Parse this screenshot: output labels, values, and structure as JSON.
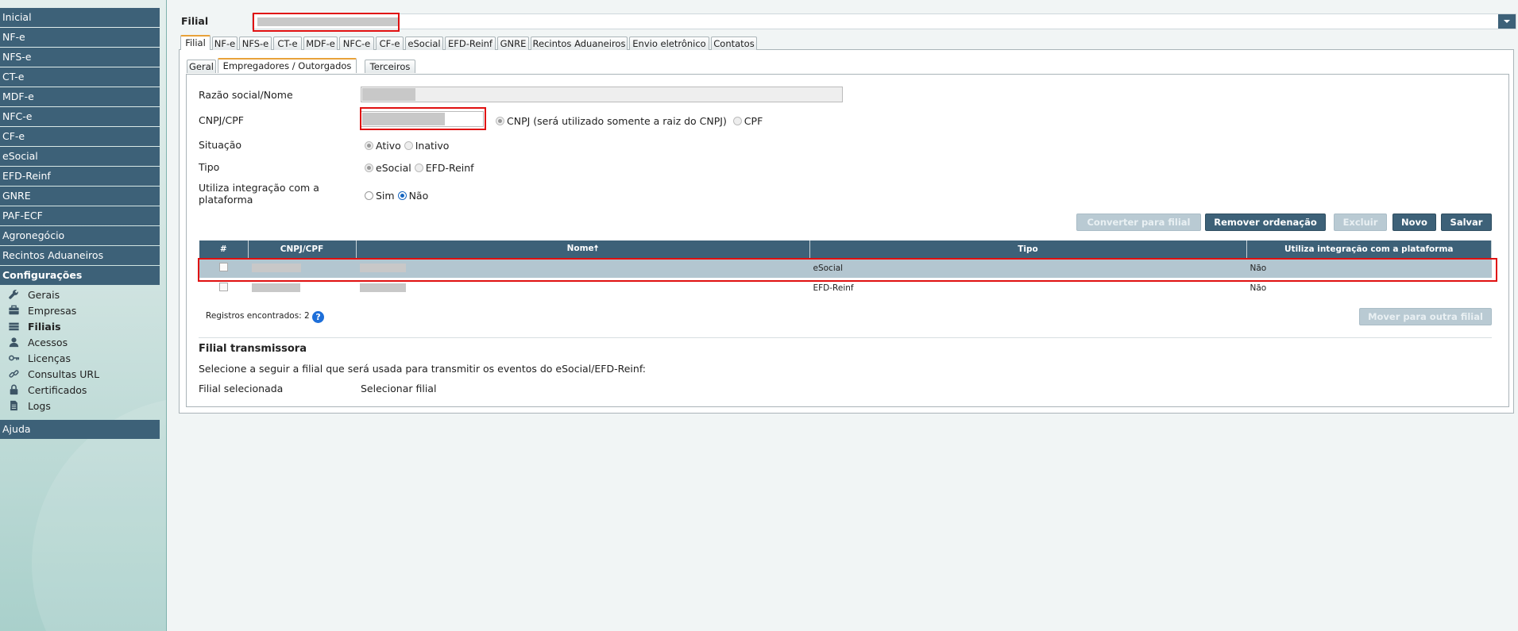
{
  "sidebar": {
    "items": [
      {
        "label": "Inicial"
      },
      {
        "label": "NF-e"
      },
      {
        "label": "NFS-e"
      },
      {
        "label": "CT-e"
      },
      {
        "label": "MDF-e"
      },
      {
        "label": "NFC-e"
      },
      {
        "label": "CF-e"
      },
      {
        "label": "eSocial"
      },
      {
        "label": "EFD-Reinf"
      },
      {
        "label": "GNRE"
      },
      {
        "label": "PAF-ECF"
      },
      {
        "label": "Agronegócio"
      },
      {
        "label": "Recintos Aduaneiros"
      }
    ],
    "config_label": "Configurações",
    "config_items": [
      {
        "label": "Gerais",
        "icon": "wrench-icon"
      },
      {
        "label": "Empresas",
        "icon": "briefcase-icon"
      },
      {
        "label": "Filiais",
        "icon": "building-icon"
      },
      {
        "label": "Acessos",
        "icon": "user-icon"
      },
      {
        "label": "Licenças",
        "icon": "key-icon"
      },
      {
        "label": "Consultas URL",
        "icon": "link-icon"
      },
      {
        "label": "Certificados",
        "icon": "lock-icon"
      },
      {
        "label": "Logs",
        "icon": "document-icon"
      }
    ],
    "help_label": "Ajuda"
  },
  "header": {
    "filial_label": "Filial"
  },
  "main_tabs": [
    {
      "label": "Filial"
    },
    {
      "label": "NF-e"
    },
    {
      "label": "NFS-e"
    },
    {
      "label": "CT-e"
    },
    {
      "label": "MDF-e"
    },
    {
      "label": "NFC-e"
    },
    {
      "label": "CF-e"
    },
    {
      "label": "eSocial"
    },
    {
      "label": "EFD-Reinf"
    },
    {
      "label": "GNRE"
    },
    {
      "label": "Recintos Aduaneiros"
    },
    {
      "label": "Envio eletrônico"
    },
    {
      "label": "Contatos"
    }
  ],
  "sub_tabs": [
    {
      "label": "Geral"
    },
    {
      "label": "Empregadores / Outorgados"
    },
    {
      "label": "Terceiros"
    }
  ],
  "form": {
    "razao_label": "Razão social/Nome",
    "cnpj_label": "CNPJ/CPF",
    "cnpj_opt": "CNPJ (será utilizado somente a raiz do CNPJ)",
    "cpf_opt": "CPF",
    "situacao_label": "Situação",
    "ativo": "Ativo",
    "inativo": "Inativo",
    "tipo_label": "Tipo",
    "esocial": "eSocial",
    "efd": "EFD-Reinf",
    "integ_label_1": "Utiliza integração com a",
    "integ_label_2": "plataforma",
    "sim": "Sim",
    "nao": "Não"
  },
  "buttons": {
    "converter": "Converter para filial",
    "remover": "Remover ordenação",
    "excluir": "Excluir",
    "novo": "Novo",
    "salvar": "Salvar",
    "mover": "Mover para outra filial"
  },
  "table": {
    "headers": [
      "#",
      "CNPJ/CPF",
      "Nome",
      "Tipo",
      "Utiliza integração com a plataforma"
    ],
    "sort_indicator": "🠅",
    "rows": [
      {
        "tipo": "eSocial",
        "integ": "Não"
      },
      {
        "tipo": "EFD-Reinf",
        "integ": "Não"
      }
    ],
    "records_label": "Registros encontrados: 2",
    "help_icon": "?"
  },
  "transmissora": {
    "title": "Filial transmissora",
    "desc": "Selecione a seguir a filial que será usada para transmitir os eventos do eSocial/EFD-Reinf:",
    "selected_label": "Filial selecionada",
    "select_link": "Selecionar filial"
  },
  "colors": {
    "nav": "#3d6178",
    "accent": "#e8a23a",
    "highlight": "#e01010"
  }
}
